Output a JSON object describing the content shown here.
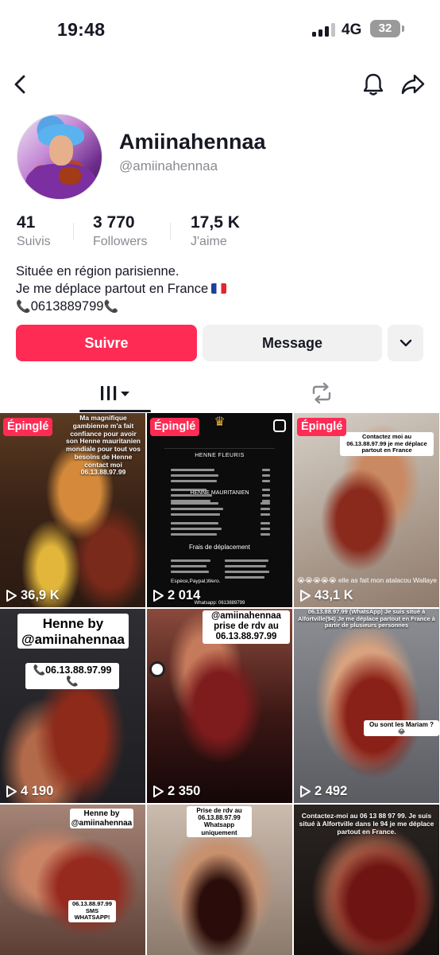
{
  "status_bar": {
    "time": "19:48",
    "network": "4G",
    "battery": "32"
  },
  "profile": {
    "display_name": "Amiinahennaa",
    "username": "@amiinahennaa",
    "stats": [
      {
        "value": "41",
        "label": "Suivis"
      },
      {
        "value": "3 770",
        "label": "Followers"
      },
      {
        "value": "17,5 K",
        "label": "J'aime"
      }
    ],
    "bio_lines": [
      "Située en région parisienne.",
      "Je me déplace partout en France",
      "0613889799"
    ]
  },
  "actions": {
    "follow_label": "Suivre",
    "message_label": "Message"
  },
  "tabs": [
    {
      "name": "videos",
      "icon": "grid-bars-icon",
      "active": true
    },
    {
      "name": "reposts",
      "icon": "repost-icon",
      "active": false
    }
  ],
  "videos": [
    {
      "pinned_label": "Épinglé",
      "views": "36,9 K",
      "overlay": "Ma magnifique gambienne m'a fait confiance pour avoir son Henne mauritanien mondiale pour tout vos besoins de Henne contact moi 06.13.88.97.99"
    },
    {
      "pinned_label": "Épinglé",
      "views": "2 014",
      "menu_title": "HENNE FLEURIS",
      "menu_title_2": "HENNE MAURITANIEN",
      "menu_title_3": "Frais de déplacement",
      "menu_footer": "Espèce,Paypal,Wero.",
      "menu_phone": "Whatsapp: 0613889799"
    },
    {
      "pinned_label": "Épinglé",
      "views": "43,1 K",
      "overlay": "Contactez moi au 06.13.88.97.99 je me déplace partout en France",
      "caption": "elle as fait mon atalacou Wallaye"
    },
    {
      "views": "4 190",
      "title": "Henne by",
      "handle": "@amiinahennaa",
      "phone": "06.13.88.97.99"
    },
    {
      "views": "2 350",
      "overlay": "@amiinahennaa prise de rdv au 06.13.88.97.99"
    },
    {
      "views": "2 492",
      "overlay": "06.13.88.97.99 (WhatsApp) Je suis situé à Alfortville(94) Je me déplace partout en France à partir de plusieurs personnes",
      "bubble": "Ou sont les Mariam ?"
    },
    {
      "title": "Henne by",
      "handle": "@amiinahennaa",
      "phone": "06.13.88.97.99",
      "sms": "SMS WHATSAPP!"
    },
    {
      "overlay": "Prise de rdv au 06.13.88.97.99 Whatsapp uniquement"
    },
    {
      "overlay": "Contactez-moi au 06 13 88 97 99. Je suis situé à Alfortville dans le 94 je me déplace partout en France."
    }
  ],
  "colors": {
    "accent": "#fe2c55",
    "secondary_button": "#f1f1f2",
    "text": "#161823",
    "muted": "#8a8b91"
  }
}
